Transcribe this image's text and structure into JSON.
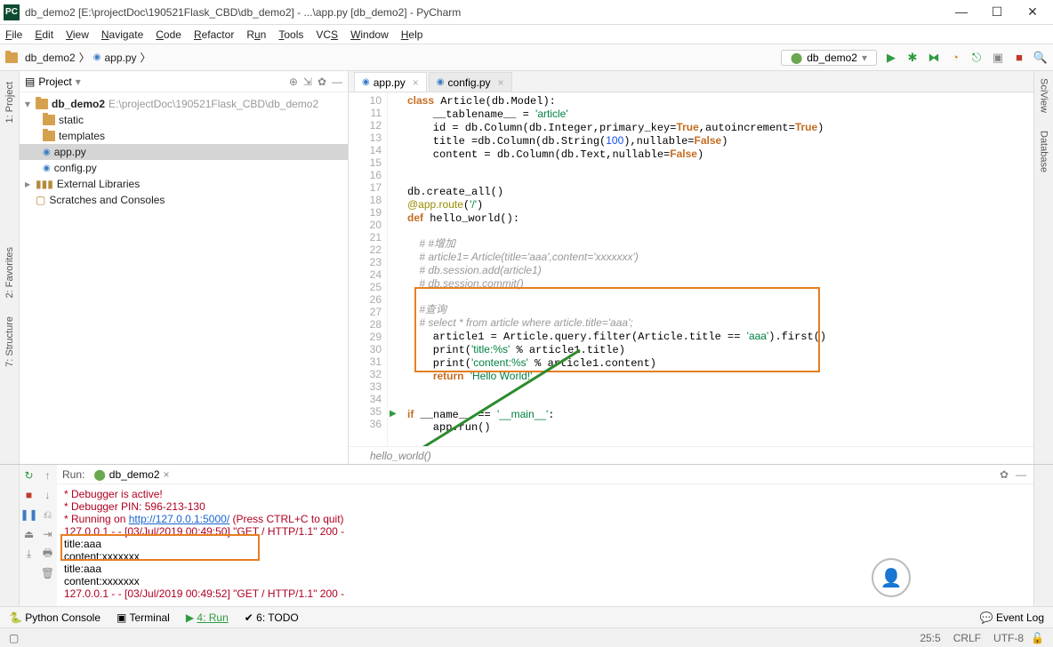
{
  "title": "db_demo2 [E:\\projectDoc\\190521Flask_CBD\\db_demo2] - ...\\app.py [db_demo2] - PyCharm",
  "menu": [
    "File",
    "Edit",
    "View",
    "Navigate",
    "Code",
    "Refactor",
    "Run",
    "Tools",
    "VCS",
    "Window",
    "Help"
  ],
  "breadcrumbs": [
    "db_demo2",
    "app.py"
  ],
  "run_config": "db_demo2",
  "project": {
    "title": "Project",
    "root": "db_demo2",
    "root_path": "E:\\projectDoc\\190521Flask_CBD\\db_demo2",
    "children": [
      "static",
      "templates",
      "app.py",
      "config.py"
    ],
    "libs": "External Libraries",
    "scratch": "Scratches and Consoles"
  },
  "tabs": [
    {
      "name": "app.py",
      "active": true
    },
    {
      "name": "config.py",
      "active": false
    }
  ],
  "code": {
    "first_line": 10,
    "last_line": 36,
    "lines": [
      "class Article(db.Model):",
      "    __tablename__ = 'article'",
      "    id = db.Column(db.Integer,primary_key=True,autoincrement=True)",
      "    title =db.Column(db.String(100),nullable=False)",
      "    content = db.Column(db.Text,nullable=False)",
      "",
      "",
      "db.create_all()",
      "@app.route('/')",
      "def hello_world():",
      "",
      "    # #增加",
      "    # article1= Article(title='aaa',content='xxxxxxx')",
      "    # db.session.add(article1)",
      "    # db.session.commit()",
      "",
      "    #查询",
      "    # select * from article where article.title='aaa';",
      "    article1 = Article.query.filter(Article.title == 'aaa').first()",
      "    print('title:%s' % article1.title)",
      "    print('content:%s' % article1.content)",
      "    return 'Hello World!'",
      "",
      "",
      "if __name__ == '__main__':",
      "    app.run()",
      ""
    ]
  },
  "breadcrumb_func": "hello_world()",
  "run": {
    "label": "Run:",
    "tab": "db_demo2",
    "lines": [
      " * Debugger is active!",
      " * Debugger PIN: 596-213-130",
      " * Running on http://127.0.0.1:5000/ (Press CTRL+C to quit)",
      "127.0.0.1 - - [03/Jul/2019 00:49:50] \"GET / HTTP/1.1\" 200 -",
      "title:aaa",
      "content:xxxxxxx",
      "title:aaa",
      "content:xxxxxxx",
      "127.0.0.1 - - [03/Jul/2019 00:49:52] \"GET / HTTP/1.1\" 200 -"
    ],
    "url": "http://127.0.0.1:5000/"
  },
  "bottom_tools": {
    "python_console": "Python Console",
    "terminal": "Terminal",
    "run": "4: Run",
    "todo": "6: TODO",
    "event_log": "Event Log"
  },
  "status": {
    "pos": "25:5",
    "eol": "CRLF",
    "enc": "UTF-8"
  },
  "side": {
    "project": "1: Project",
    "favorites": "2: Favorites",
    "structure": "7: Structure",
    "sciview": "SciView",
    "database": "Database"
  }
}
